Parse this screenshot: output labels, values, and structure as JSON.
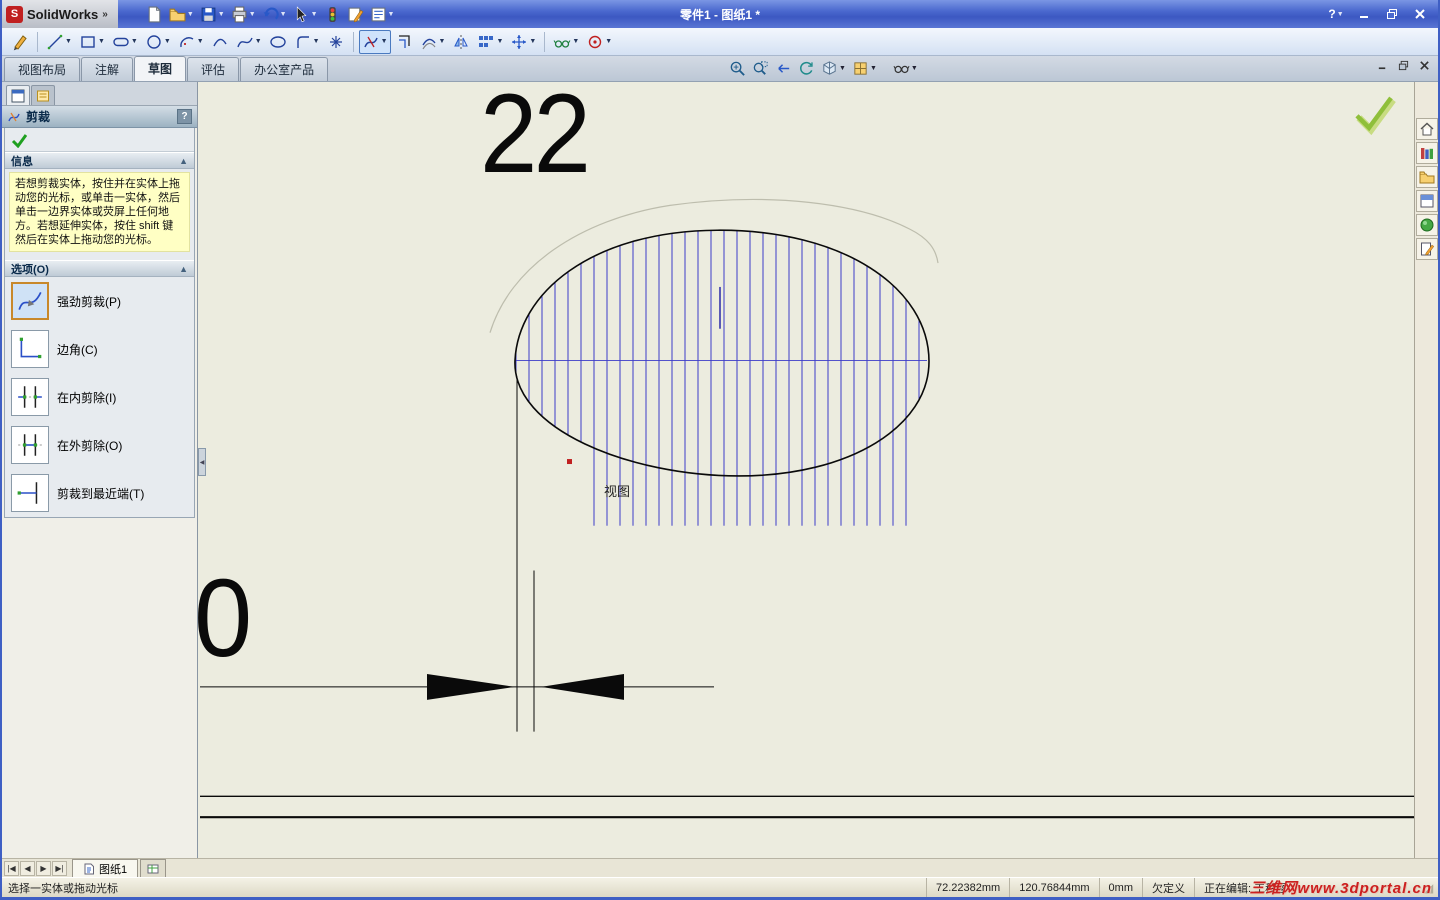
{
  "window": {
    "brand": "SolidWorks",
    "title": "零件1 - 图纸1 *",
    "help_label": "?"
  },
  "main_toolbar": {
    "icons": [
      "new-document",
      "open",
      "save",
      "print",
      "undo",
      "select",
      "rebuild",
      "edit-sketch",
      "design-table"
    ]
  },
  "sketch_toolbar": {
    "icons": [
      "sketch",
      "line",
      "corner-rectangle",
      "straight-slot",
      "circle",
      "centerpoint-arc",
      "tangent-arc",
      "spline",
      "ellipse",
      "sketch-fillet",
      "point",
      "trim-entities",
      "convert-entities",
      "offset-entities",
      "mirror-entities",
      "linear-sketch-pattern",
      "move-entities",
      "display-delete-relations",
      "quick-snaps"
    ],
    "active_tool": "trim-entities"
  },
  "command_tabs": {
    "tabs": [
      {
        "label": "视图布局",
        "active": false
      },
      {
        "label": "注解",
        "active": false
      },
      {
        "label": "草图",
        "active": true
      },
      {
        "label": "评估",
        "active": false
      },
      {
        "label": "办公室产品",
        "active": false
      }
    ]
  },
  "headsup_toolbar": {
    "icons": [
      "zoom-to-fit",
      "zoom-to-area",
      "previous-view",
      "rotate-view",
      "view-orientation",
      "display-style",
      "view-settings"
    ]
  },
  "document_window": {
    "controls": [
      "minimize",
      "restore",
      "close"
    ]
  },
  "property_manager": {
    "title": "剪裁",
    "help": "?",
    "info": {
      "title": "信息",
      "message": "若想剪裁实体，按住并在实体上拖动您的光标，或单击一实体，然后单击一边界实体或荧屏上任何地方。若想延伸实体，按住 shift 键然后在实体上拖动您的光标。"
    },
    "options": {
      "title": "选项(O)",
      "items": [
        {
          "label": "强劲剪裁(P)",
          "selected": true
        },
        {
          "label": "边角(C)",
          "selected": false
        },
        {
          "label": "在内剪除(I)",
          "selected": false
        },
        {
          "label": "在外剪除(O)",
          "selected": false
        },
        {
          "label": "剪裁到最近端(T)",
          "selected": false
        }
      ]
    }
  },
  "taskpane": {
    "icons": [
      "solidworks-resources",
      "design-library",
      "file-explorer",
      "view-palette",
      "appearances-scenes",
      "custom-properties"
    ]
  },
  "viewport": {
    "dimension_top": "22",
    "dimension_left": "0",
    "view_label": "视图",
    "hatch_color": "#3c3cc8",
    "background_color": "#ececdf"
  },
  "sheet_bar": {
    "nav": [
      "first",
      "previous",
      "next",
      "last"
    ],
    "tabs": [
      {
        "label": "图纸1",
        "active": true
      }
    ]
  },
  "status_bar": {
    "message": "选择一实体或拖动光标",
    "x": "72.22382mm",
    "y": "120.76844mm",
    "z": "0mm",
    "state": "欠定义",
    "editing": "正在编辑: 工程图",
    "watermark": "三维网www.3dportal.cn"
  }
}
